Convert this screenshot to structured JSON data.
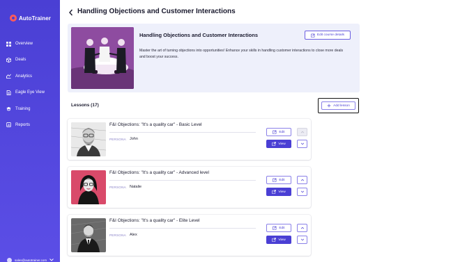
{
  "sidebar": {
    "brand": "AutoTrainer",
    "items": [
      {
        "label": "Overview",
        "icon": "grid-icon"
      },
      {
        "label": "Deals",
        "icon": "box-icon"
      },
      {
        "label": "Analytics",
        "icon": "chart-icon"
      },
      {
        "label": "Eagle Eye View",
        "icon": "document-icon"
      },
      {
        "label": "Training",
        "icon": "graduation-cap-icon"
      },
      {
        "label": "Reports",
        "icon": "report-icon"
      }
    ],
    "user_email": "sales@autotrainer.com"
  },
  "header": {
    "title": "Handling Objections and Customer Interactions"
  },
  "course": {
    "title": "Handling Objections and Customer Interactions",
    "description": "Master the art of turning objections into opportunities! Enhance your skills in handling customer interactions to close more deals and boost your success.",
    "edit_label": "Edit course details"
  },
  "lessons": {
    "heading": "Lessons (17)",
    "add_label": "Add lesson",
    "persona_label": "PERSONA",
    "edit_label": "Edit",
    "view_label": "View",
    "items": [
      {
        "title": "F&I Objections: \"It's a quality car\" - Basic Level",
        "persona": "John",
        "can_move_up": false
      },
      {
        "title": "F&I Objections: \"It's a quality car\" - Advanced level",
        "persona": "Natalie",
        "can_move_up": true
      },
      {
        "title": "F&I Objections: \"It's a quality car\" - Elite Level",
        "persona": "Alex",
        "can_move_up": true
      }
    ]
  },
  "colors": {
    "sidebar": "#4a3fd4",
    "accent": "#4a3fd4",
    "brand_logo": "#ff5b5b",
    "course_card_bg": "#eef0fb"
  }
}
